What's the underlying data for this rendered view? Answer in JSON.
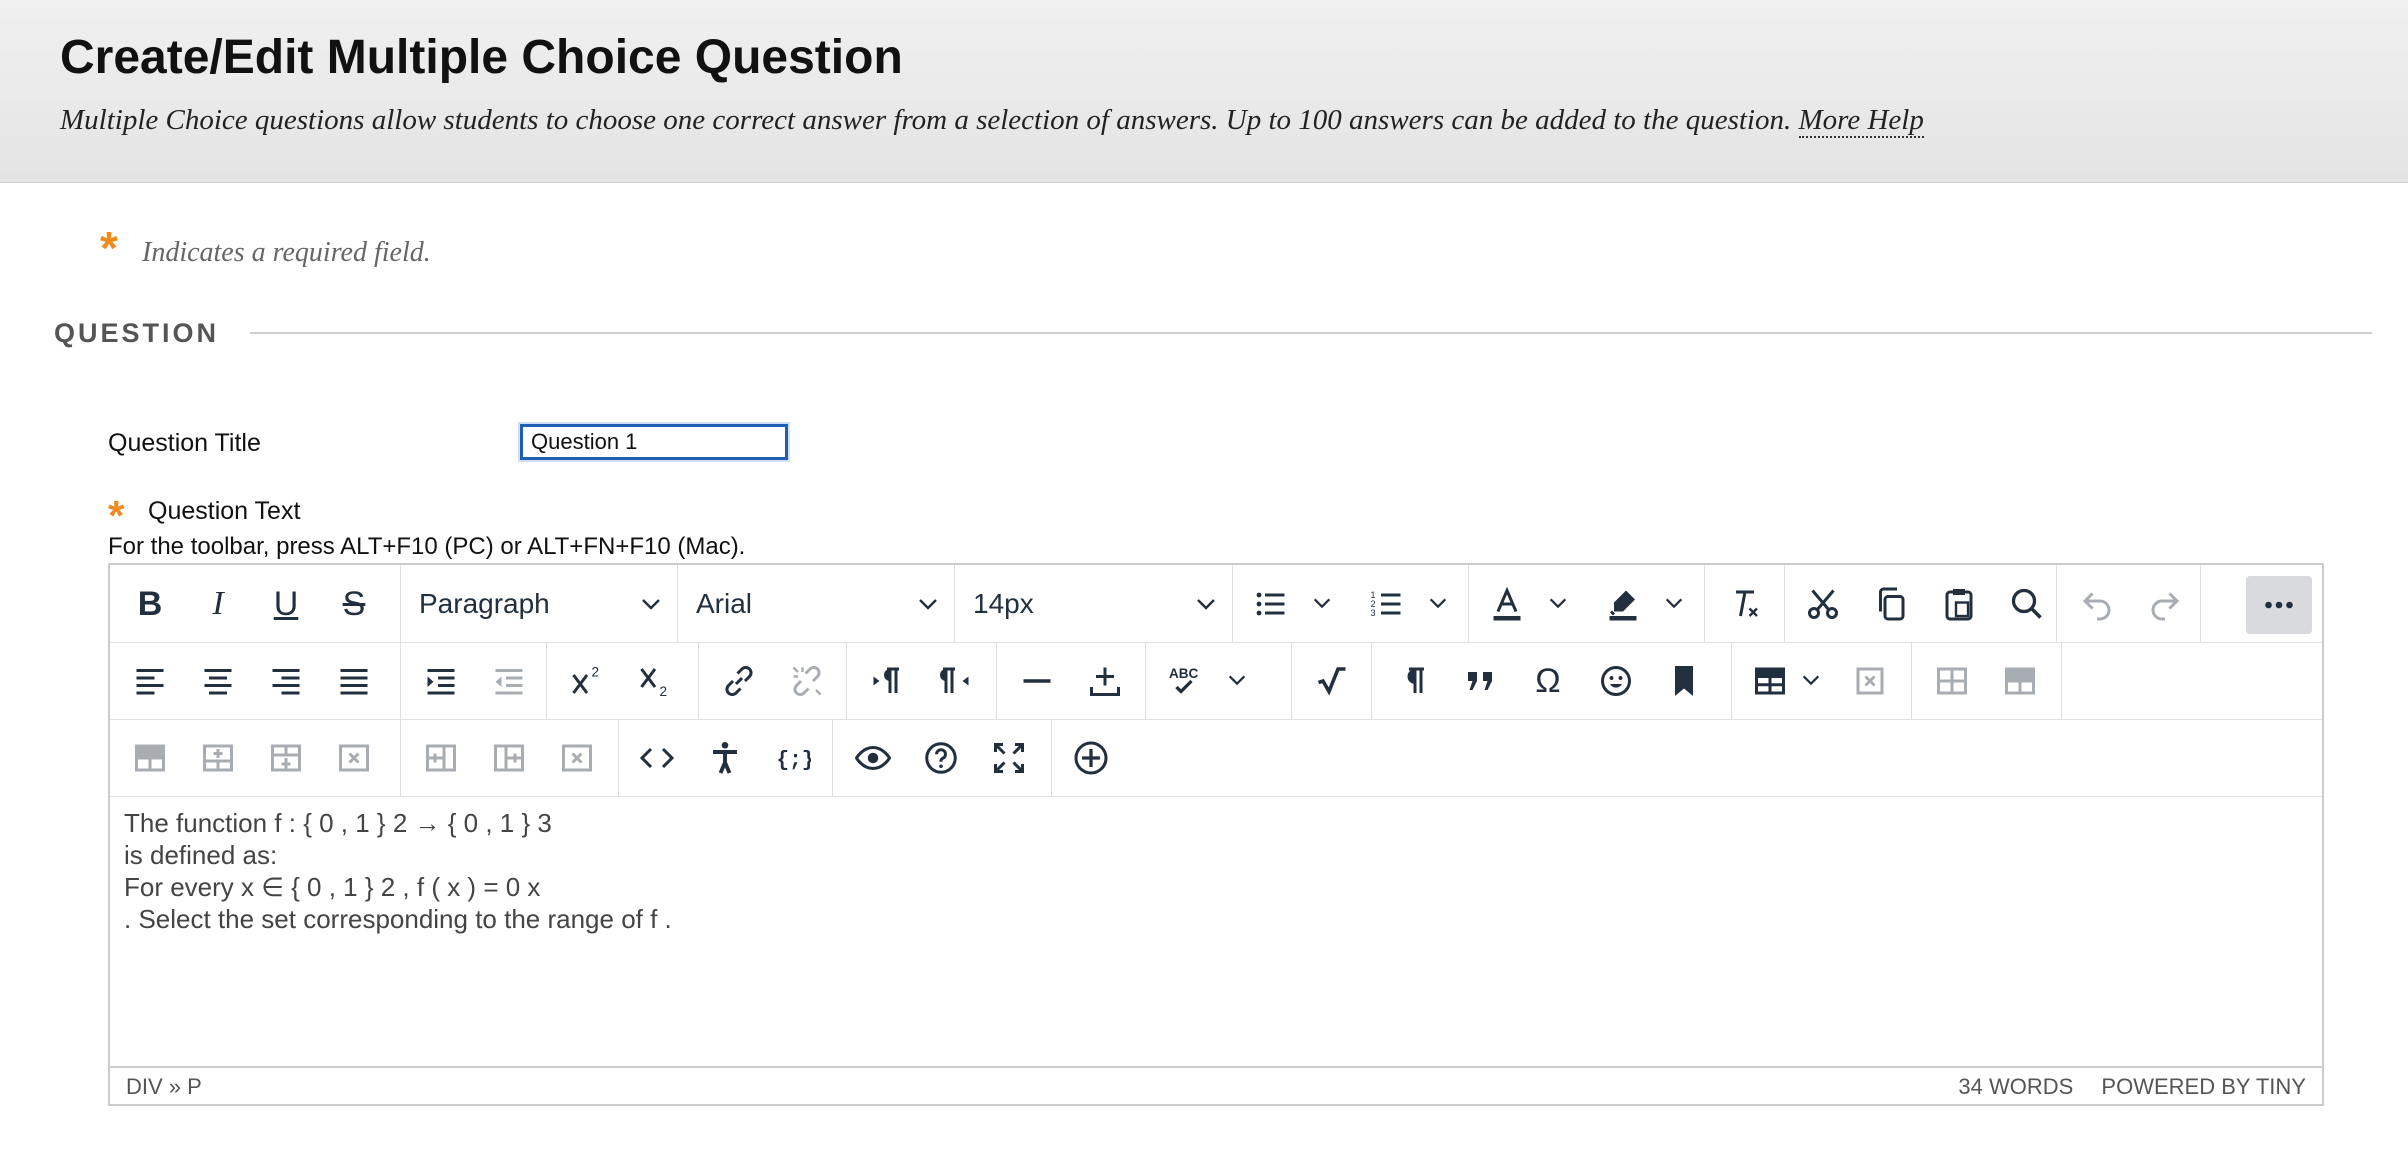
{
  "header": {
    "title": "Create/Edit Multiple Choice Question",
    "description": "Multiple Choice questions allow students to choose one correct answer from a selection of answers. Up to 100 answers can be added to the question.",
    "more_help": "More Help"
  },
  "required_note": {
    "star": "*",
    "text": "Indicates a required field."
  },
  "section": {
    "title": "QUESTION"
  },
  "question_title": {
    "label": "Question Title",
    "value": "Question 1"
  },
  "question_text": {
    "star": "*",
    "label": "Question Text",
    "toolbar_hint": "For the toolbar, press ALT+F10 (PC) or ALT+FN+F10 (Mac)."
  },
  "editor": {
    "block_format": "Paragraph",
    "font_family": "Arial",
    "font_size": "14px",
    "content_lines": [
      "The function f : { 0 , 1 } 2 → { 0 , 1 } 3",
      "is defined as:",
      "For every x ∈ { 0 , 1 } 2 , f ( x ) = 0 x",
      ". Select the set corresponding to the range of f ."
    ],
    "status_path": "DIV » P",
    "word_count": "34 WORDS",
    "powered_by": "POWERED BY TINY"
  },
  "colors": {
    "accent": "#f08a1c",
    "focus": "#1f5fb3",
    "icon": "#222f3e",
    "disabled": "#a8adb3"
  }
}
